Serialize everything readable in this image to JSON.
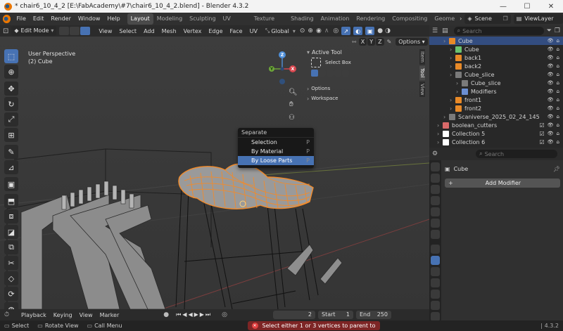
{
  "window": {
    "title": "* chair6_10_4_2 [E:\\FabAcademy\\#7\\chair6_10_4_2.blend] - Blender 4.3.2",
    "minimize": "—",
    "maximize": "☐",
    "close": "✕"
  },
  "menubar": {
    "items": [
      "File",
      "Edit",
      "Render",
      "Window",
      "Help"
    ],
    "workspaces": [
      "Layout",
      "Modeling",
      "Sculpting",
      "UV Editing",
      "Texture Paint",
      "Shading",
      "Animation",
      "Rendering",
      "Compositing",
      "Geome"
    ],
    "active_workspace": "Layout",
    "scene": "Scene",
    "view_layer": "ViewLayer"
  },
  "viewport_header": {
    "mode": "Edit Mode",
    "menus": [
      "View",
      "Select",
      "Add",
      "Mesh",
      "Vertex",
      "Edge",
      "Face",
      "UV"
    ],
    "transform_orientation": "Global",
    "axes": [
      "X",
      "Y",
      "Z"
    ],
    "options": "Options"
  },
  "viewport": {
    "perspective": "User Perspective",
    "object": "(2) Cube",
    "active_tool_label": "Active Tool",
    "select_box": "Select Box",
    "options_label": "Options",
    "workspace_label": "Workspace",
    "side_tabs": [
      "Item",
      "Tool",
      "View"
    ],
    "gizmo": {
      "x": "X",
      "y": "Y",
      "z": "Z"
    }
  },
  "separate_menu": {
    "title": "Separate",
    "items": [
      {
        "label": "Selection",
        "key": "P"
      },
      {
        "label": "By Material",
        "key": "P"
      },
      {
        "label": "By Loose Parts",
        "key": "P"
      }
    ]
  },
  "outliner": {
    "search_placeholder": "Search",
    "rows": [
      {
        "label": "Cube",
        "indent": 2,
        "selected": true,
        "color": "#e88a28"
      },
      {
        "label": "Cube",
        "indent": 3,
        "selected": false,
        "color": "#6ac26f"
      },
      {
        "label": "back1",
        "indent": 3,
        "selected": false,
        "color": "#e88a28"
      },
      {
        "label": "back2",
        "indent": 3,
        "selected": false,
        "color": "#e88a28"
      },
      {
        "label": "Cube_slice",
        "indent": 3,
        "selected": false,
        "color": "#7a7a7a"
      },
      {
        "label": "Cube_slice",
        "indent": 4,
        "selected": false,
        "color": "#7a7a7a"
      },
      {
        "label": "Modifiers",
        "indent": 4,
        "selected": false,
        "color": "#6b8fd3"
      },
      {
        "label": "front1",
        "indent": 3,
        "selected": false,
        "color": "#e88a28"
      },
      {
        "label": "front2",
        "indent": 3,
        "selected": false,
        "color": "#e88a28"
      },
      {
        "label": "Scaniverse_2025_02_24_145",
        "indent": 2,
        "selected": false,
        "color": "#7a7a7a"
      },
      {
        "label": "boolean_cutters",
        "indent": 1,
        "selected": false,
        "color": "#d96a6a"
      },
      {
        "label": "Collection 5",
        "indent": 1,
        "selected": false,
        "color": "#ffffff"
      },
      {
        "label": "Collection 6",
        "indent": 1,
        "selected": false,
        "color": "#ffffff"
      }
    ]
  },
  "properties": {
    "search_placeholder": "Search",
    "object_name": "Cube",
    "add_modifier": "Add Modifier"
  },
  "timeline": {
    "menus": [
      "Playback",
      "Keying",
      "View",
      "Marker"
    ],
    "current_frame": "2",
    "start_label": "Start",
    "start": "1",
    "end_label": "End",
    "end": "250"
  },
  "statusbar": {
    "select": "Select",
    "rotate_view": "Rotate View",
    "call_menu": "Call Menu",
    "error": "Select either 1 or 3 vertices to parent to",
    "version": "4.3.2"
  }
}
